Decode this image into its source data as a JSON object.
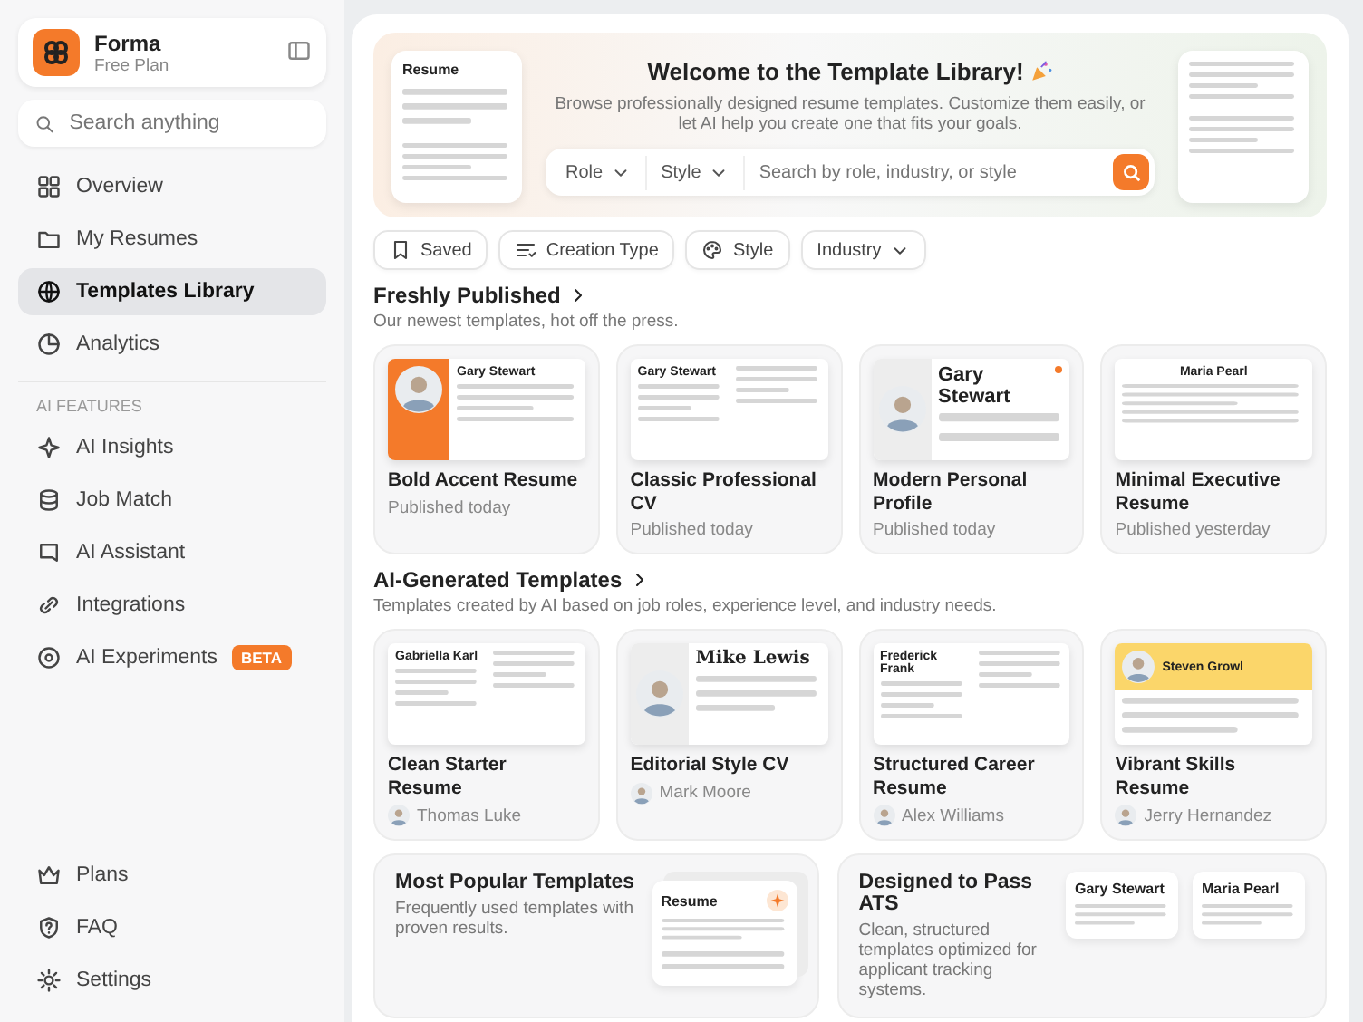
{
  "sidebar": {
    "brand": {
      "name": "Forma",
      "plan": "Free Plan"
    },
    "search": {
      "placeholder": "Search anything"
    },
    "nav": [
      {
        "label": "Overview",
        "selected": false
      },
      {
        "label": "My Resumes",
        "selected": false
      },
      {
        "label": "Templates Library",
        "selected": true
      },
      {
        "label": "Analytics",
        "selected": false
      }
    ],
    "section_label": "AI FEATURES",
    "ai_items": [
      {
        "label": "AI Insights",
        "selected": false
      },
      {
        "label": "Job Match",
        "selected": false
      },
      {
        "label": "AI Assistant",
        "selected": false
      },
      {
        "label": "Integrations",
        "selected": false
      },
      {
        "label": "AI Experiments",
        "selected": false,
        "badge": "BETA"
      }
    ],
    "footer": [
      {
        "label": "Plans",
        "selected": false
      },
      {
        "label": "FAQ",
        "selected": false
      },
      {
        "label": "Settings",
        "selected": false
      }
    ]
  },
  "banner": {
    "title": "Welcome to the Template Library!",
    "subtitle": "Browse professionally designed resume templates. Customize them easily, or let AI help you create one that fits your goals.",
    "decor_label": "Resume",
    "search": {
      "filters": [
        "Role",
        "Style"
      ],
      "placeholder": "Search by role, industry, or style"
    }
  },
  "filters": [
    {
      "label": "Saved",
      "kind": "chip"
    },
    {
      "label": "Creation Type",
      "kind": "chip"
    },
    {
      "label": "Style",
      "kind": "chip"
    },
    {
      "label": "Industry",
      "kind": "dropdown"
    }
  ],
  "sections": [
    {
      "title": "Freshly Published",
      "subtitle": "Our newest templates, hot off the press.",
      "cards": [
        {
          "title": "Bold Accent Resume",
          "published": "Published today",
          "preview": {
            "kind": "accent",
            "name": "Gary Stewart"
          }
        },
        {
          "title": "Classic Professional CV",
          "published": "Published today",
          "preview": {
            "kind": "classic",
            "name": "Gary Stewart"
          }
        },
        {
          "title": "Modern Personal Profile",
          "published": "Published today",
          "preview": {
            "kind": "portrait",
            "name": "Gary Stewart"
          }
        },
        {
          "title": "Minimal Executive Resume",
          "published": "Published yesterday",
          "preview": {
            "kind": "centered",
            "name": "Maria Pearl"
          }
        }
      ]
    },
    {
      "title": "AI-Generated Templates",
      "subtitle": "Templates created by AI based on job roles, experience level, and industry needs.",
      "cards": [
        {
          "title": "Clean Starter Resume",
          "author": "Thomas Luke",
          "preview": {
            "kind": "classic",
            "name": "Gabriella Karl"
          }
        },
        {
          "title": "Editorial Style CV",
          "author": "Mark Moore",
          "preview": {
            "kind": "serif",
            "name": "Mike Lewis"
          }
        },
        {
          "title": "Structured Career Resume",
          "author": "Alex Williams",
          "preview": {
            "kind": "classic",
            "name": "Frederick Frank"
          }
        },
        {
          "title": "Vibrant Skills Resume",
          "author": "Jerry Hernandez",
          "preview": {
            "kind": "banner",
            "name": "Steven Growl"
          }
        }
      ]
    }
  ],
  "promos": [
    {
      "title": "Most Popular Templates",
      "description": "Frequently used templates with proven results.",
      "kind": "stack",
      "labels": [
        "Resume"
      ]
    },
    {
      "title": "Designed to Pass ATS",
      "description": "Clean, structured templates optimized for applicant tracking systems.",
      "kind": "pair",
      "labels": [
        "Gary Stewart",
        "Maria Pearl"
      ]
    }
  ]
}
